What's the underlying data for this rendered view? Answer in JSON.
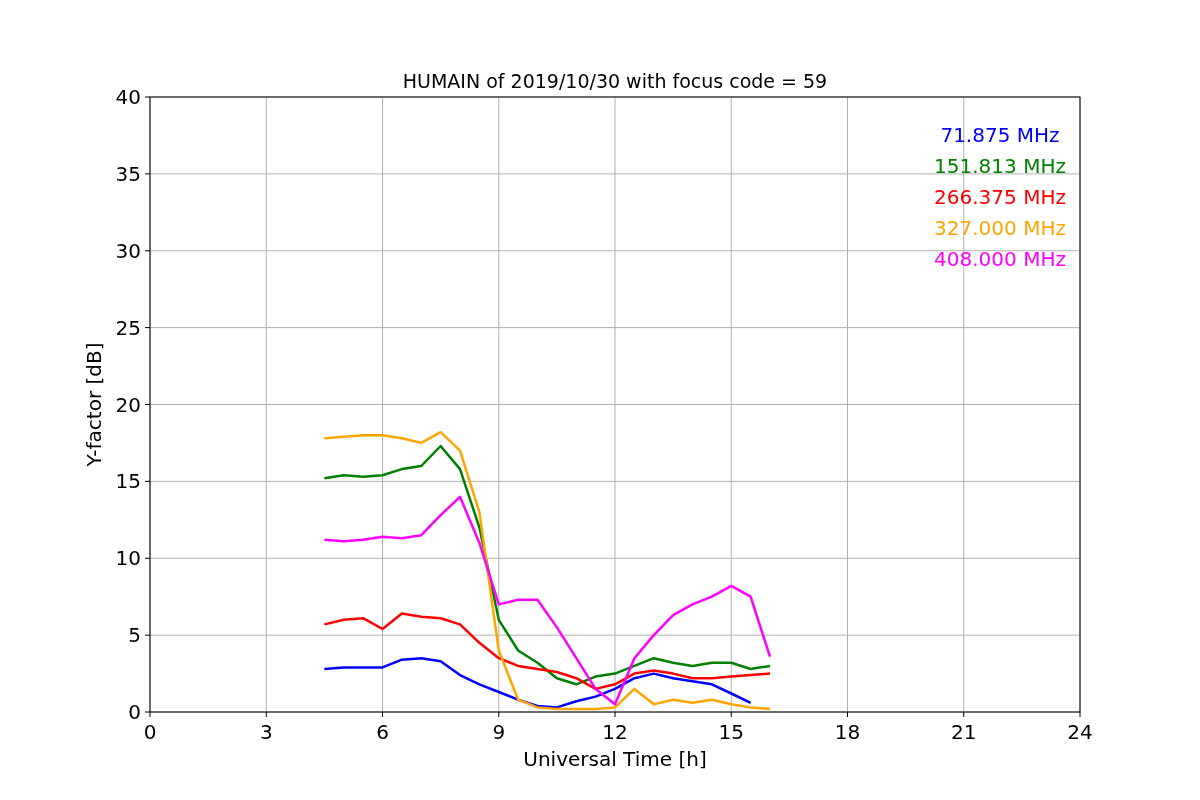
{
  "figure": {
    "chart_data": {
      "type": "line",
      "title": "HUMAIN of 2019/10/30 with focus code = 59",
      "xlabel": "Universal Time [h]",
      "ylabel": "Y-factor [dB]",
      "x": [
        4.5,
        5,
        5.5,
        6,
        6.5,
        7,
        7.5,
        8,
        8.5,
        9,
        9.5,
        10,
        10.5,
        11,
        11.5,
        12,
        12.5,
        13,
        13.5,
        14,
        14.5,
        15,
        15.5,
        16
      ],
      "series": [
        {
          "name": "71.875 MHz",
          "color": "#0000ff",
          "values": [
            2.8,
            2.9,
            2.9,
            2.9,
            3.4,
            3.5,
            3.3,
            2.4,
            1.8,
            1.3,
            0.8,
            0.4,
            0.3,
            0.7,
            1.0,
            1.5,
            2.2,
            2.5,
            2.2,
            2.0,
            1.8,
            1.2,
            0.6,
            null
          ]
        },
        {
          "name": "151.813 MHz",
          "color": "#008000",
          "values": [
            15.2,
            15.4,
            15.3,
            15.4,
            15.8,
            16,
            17.3,
            15.8,
            12,
            6,
            4,
            3.2,
            2.2,
            1.8,
            2.3,
            2.5,
            3,
            3.5,
            3.2,
            3,
            3.2,
            3.2,
            2.8,
            3
          ]
        },
        {
          "name": "266.375 MHz",
          "color": "#ff0000",
          "values": [
            5.7,
            6,
            6.1,
            5.4,
            6.4,
            6.2,
            6.1,
            5.7,
            4.5,
            3.5,
            3,
            2.8,
            2.6,
            2.2,
            1.5,
            1.8,
            2.5,
            2.7,
            2.5,
            2.2,
            2.2,
            2.3,
            2.4,
            2.5
          ]
        },
        {
          "name": "327.000 MHz",
          "color": "#ffa500",
          "values": [
            17.8,
            17.9,
            18,
            18,
            17.8,
            17.5,
            18.2,
            17,
            13,
            4,
            0.8,
            0.3,
            0.2,
            0.2,
            0.2,
            0.3,
            1.5,
            0.5,
            0.8,
            0.6,
            0.8,
            0.5,
            0.3,
            0.2
          ]
        },
        {
          "name": "408.000 MHz",
          "color": "#ff00ff",
          "values": [
            11.2,
            11.1,
            11.2,
            11.4,
            11.3,
            11.5,
            12.8,
            14,
            11,
            7,
            7.3,
            7.3,
            5.5,
            3.5,
            1.5,
            0.5,
            3.5,
            5,
            6.3,
            7,
            7.5,
            8.2,
            7.5,
            3.6
          ]
        }
      ],
      "grid": true,
      "xlim": [
        0,
        24
      ],
      "ylim": [
        0,
        40
      ],
      "xticks": [
        0,
        3,
        6,
        9,
        12,
        15,
        18,
        21,
        24
      ],
      "yticks": [
        0,
        5,
        10,
        15,
        20,
        25,
        30,
        35,
        40
      ]
    }
  }
}
